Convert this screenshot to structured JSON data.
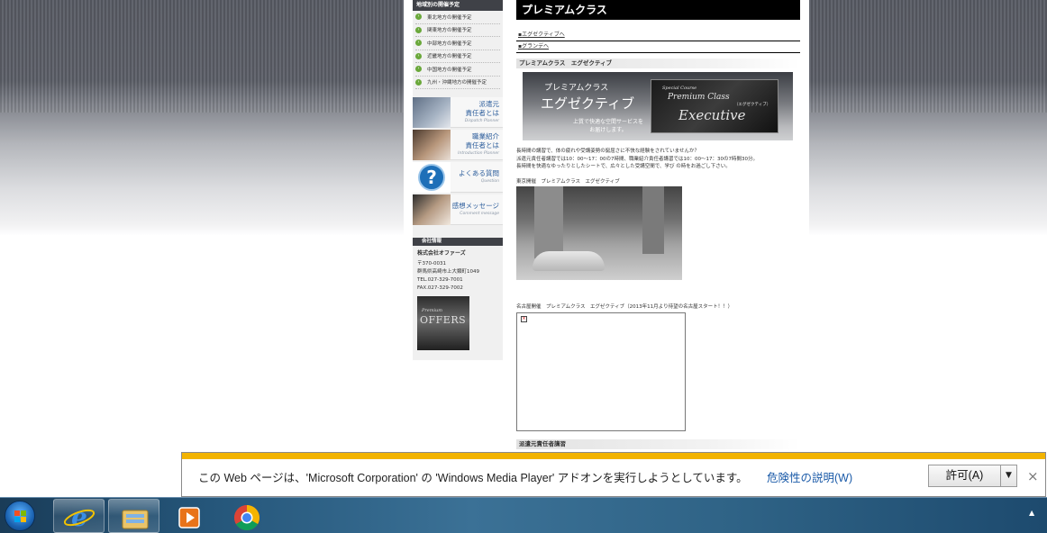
{
  "sidebar": {
    "schedule_heading": "地域別の開催予定",
    "schedule_items": [
      "東北地方の開催予定",
      "関東地方の開催予定",
      "中部地方の開催予定",
      "近畿地方の開催予定",
      "中国地方の開催予定",
      "九州・沖縄地方の開催予定"
    ],
    "banners": [
      {
        "jp": "派遣元\n責任者とは",
        "en": "Dispatch Planner"
      },
      {
        "jp": "職業紹介\n責任者とは",
        "en": "Introduction Planner"
      },
      {
        "jp": "よくある質問",
        "en": "Question"
      },
      {
        "jp": "感想メッセージ",
        "en": "Comment message"
      }
    ],
    "company_heading": "会社情報",
    "company_name": "株式会社オファーズ",
    "postal": "〒370-0031",
    "address": "群馬県高崎市上大類町1049",
    "tel": "TEL.027-329-7001",
    "fax": "FAX.027-329-7002",
    "logo_premium": "Premium",
    "logo_word": "OFFERS"
  },
  "main": {
    "title": "プレミアムクラス",
    "links": [
      "エグゼクティブへ",
      "グランデへ"
    ],
    "section_executive": "プレミアムクラス　エグゼクティブ",
    "banner": {
      "small_title": "プレミアムクラス",
      "big_title": "エグゼクティブ",
      "sub": "上質で快適な空間サービスを\nお届けします。",
      "special_course": "Special Course",
      "premium_class": "Premium Class",
      "executive": "Executive",
      "kana": "（エグゼクティブ）"
    },
    "description": [
      "長時間の講習で、体の疲れや受講姿勢の窮屈さに不快な経験をされていませんか？",
      "派遣元責任者講習では10：00～17：00の7時間、職業紹介責任者講習では10：00～17：30の7時間30分。",
      "長時間を快適なゆったりとしたシートで、広々とした受講空間で、学び の時をお過ごし下さい。"
    ],
    "caption_tokyo": "東京開催　プレミアムクラス　エグゼクティブ",
    "caption_nagoya": "名古屋開催　プレミアムクラス　エグゼクティブ（2013年11月より待望の名古屋スタート！！）",
    "section_next": "派遣元責任者講習"
  },
  "notification": {
    "message": "この Web ページは、'Microsoft Corporation' の 'Windows Media Player' アドオンを実行しようとしています。",
    "risk_link": "危険性の説明(W)",
    "allow_button": "許可(A)",
    "dropdown_icon": "▼",
    "close_icon": "×"
  },
  "taskbar": {
    "items": [
      "start-button",
      "internet-explorer-icon",
      "file-explorer-icon",
      "media-player-icon",
      "chrome-icon"
    ],
    "tray_arrow": "▲"
  },
  "colors": {
    "notify_stripe": "#f2b300",
    "link_blue": "#1a5aa8",
    "title_black": "#000000"
  }
}
